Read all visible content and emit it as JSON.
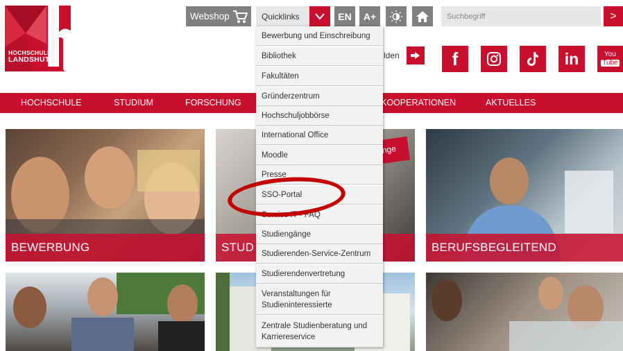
{
  "logo": {
    "line1": "HOCHSCHULE",
    "line2": "LANDSHUT"
  },
  "topbar": {
    "webshop_label": "Webshop",
    "quicklinks_label": "Quicklinks",
    "lang_label": "EN",
    "font_label": "A+",
    "search_placeholder": "Suchbegriff",
    "search_btn": ">"
  },
  "login": {
    "partial_label": "lden"
  },
  "social": {
    "youtube_top": "You",
    "youtube_bottom": "Tube",
    "linkedin": "in",
    "facebook": "f"
  },
  "nav": {
    "items": [
      "HOCHSCHULE",
      "STUDIUM",
      "FORSCHUNG",
      "KOOPERATIONEN",
      "AKTUELLES"
    ]
  },
  "tiles": {
    "bewerbung": "BEWERBUNG",
    "studium_partial": "STUD",
    "berufsbegleitend": "BERUFSBEGLEITEND",
    "badge_partial": "nge"
  },
  "quicklinks": [
    "Bewerbung und Einschreibung",
    "Bibliothek",
    "Fakultäten",
    "Gründerzentrum",
    "Hochschuljobbörse",
    "International Office",
    "Moodle",
    "Presse",
    "SSO-Portal",
    "Service IT - FAQ",
    "Studiengänge",
    "Studierenden-Service-Zentrum",
    "Studierendenvertretung",
    "Veranstaltungen für Studieninteressierte",
    "Zentrale Studienberatung und Karriereservice"
  ],
  "colors": {
    "brand": "#c8102e",
    "gray_button": "#808080",
    "input_bg": "#e7e7e7"
  }
}
